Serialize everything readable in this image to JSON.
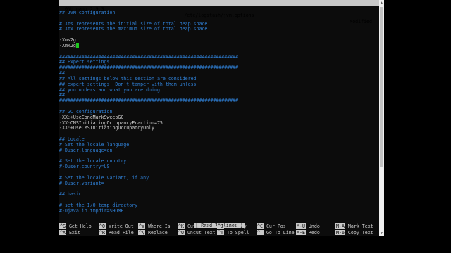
{
  "titlebar": {
    "app": "GNU nano 2.9.3",
    "path": "/etc/logstash/jvm.options",
    "state": "Modified"
  },
  "editor": {
    "lines": [
      {
        "text": "## JVM configuration",
        "type": "comment"
      },
      {
        "text": "",
        "type": "blank"
      },
      {
        "text": "# Xms represents the initial size of total heap space",
        "type": "comment"
      },
      {
        "text": "# Xmx represents the maximum size of total heap space",
        "type": "comment"
      },
      {
        "text": "",
        "type": "blank"
      },
      {
        "text": "-Xms2g",
        "type": "code"
      },
      {
        "text": "-Xmx2g",
        "type": "code",
        "cursor_after": true
      },
      {
        "text": "",
        "type": "blank"
      },
      {
        "text": "################################################################",
        "type": "comment"
      },
      {
        "text": "## Expert settings",
        "type": "comment"
      },
      {
        "text": "################################################################",
        "type": "comment"
      },
      {
        "text": "##",
        "type": "comment"
      },
      {
        "text": "## All settings below this section are considered",
        "type": "comment"
      },
      {
        "text": "## expert settings. Don't tamper with them unless",
        "type": "comment"
      },
      {
        "text": "## you understand what you are doing",
        "type": "comment"
      },
      {
        "text": "##",
        "type": "comment"
      },
      {
        "text": "################################################################",
        "type": "comment"
      },
      {
        "text": "",
        "type": "blank"
      },
      {
        "text": "## GC configuration",
        "type": "comment"
      },
      {
        "text": "-XX:+UseConcMarkSweepGC",
        "type": "code"
      },
      {
        "text": "-XX:CMSInitiatingOccupancyFraction=75",
        "type": "code"
      },
      {
        "text": "-XX:+UseCMSInitiatingOccupancyOnly",
        "type": "code"
      },
      {
        "text": "",
        "type": "blank"
      },
      {
        "text": "## Locale",
        "type": "comment"
      },
      {
        "text": "# Set the locale language",
        "type": "comment"
      },
      {
        "text": "#-Duser.language=en",
        "type": "comment"
      },
      {
        "text": "",
        "type": "blank"
      },
      {
        "text": "# Set the locale country",
        "type": "comment"
      },
      {
        "text": "#-Duser.country=US",
        "type": "comment"
      },
      {
        "text": "",
        "type": "blank"
      },
      {
        "text": "# Set the locale variant, if any",
        "type": "comment"
      },
      {
        "text": "#-Duser.variant=",
        "type": "comment"
      },
      {
        "text": "",
        "type": "blank"
      },
      {
        "text": "## basic",
        "type": "comment"
      },
      {
        "text": "",
        "type": "blank"
      },
      {
        "text": "# set the I/O temp directory",
        "type": "comment"
      },
      {
        "text": "#-Djava.io.tmpdir=$HOME",
        "type": "comment"
      }
    ]
  },
  "status": "[ Read 76 lines ]",
  "shortcuts": {
    "row1": [
      {
        "key": "^G",
        "label": "Get Help"
      },
      {
        "key": "^O",
        "label": "Write Out"
      },
      {
        "key": "^W",
        "label": "Where Is"
      },
      {
        "key": "^K",
        "label": "Cut Text"
      },
      {
        "key": "^J",
        "label": "Justify"
      },
      {
        "key": "^C",
        "label": "Cur Pos"
      },
      {
        "key": "M-U",
        "label": "Undo"
      },
      {
        "key": "M-A",
        "label": "Mark Text"
      }
    ],
    "row2": [
      {
        "key": "^X",
        "label": "Exit"
      },
      {
        "key": "^R",
        "label": "Read File"
      },
      {
        "key": "^\\",
        "label": "Replace"
      },
      {
        "key": "^U",
        "label": "Uncut Text"
      },
      {
        "key": "^T",
        "label": "To Spell"
      },
      {
        "key": "^_",
        "label": "Go To Line"
      },
      {
        "key": "M-E",
        "label": "Redo"
      },
      {
        "key": "M-6",
        "label": "Copy Text"
      }
    ]
  },
  "colors": {
    "background": "#0c0c0c",
    "comment": "#2f7fd4",
    "text": "#cfcfcf",
    "bar": "#c8c8c8",
    "cursor": "#1ec81e"
  }
}
